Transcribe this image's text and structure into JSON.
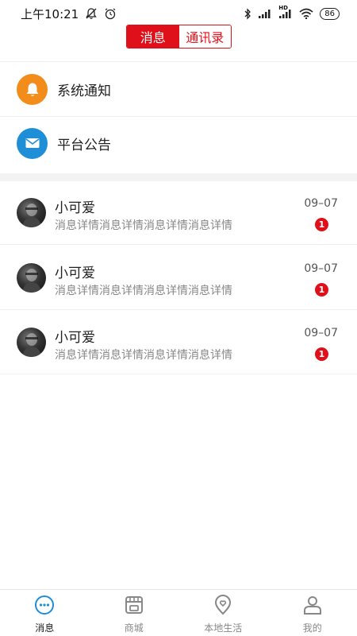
{
  "status_bar": {
    "time": "上午10:21",
    "battery": "86",
    "network_label": "HD"
  },
  "header": {
    "tabs": [
      {
        "label": "消息",
        "active": true
      },
      {
        "label": "通讯录",
        "active": false
      }
    ]
  },
  "quick_items": [
    {
      "label": "系统通知",
      "icon": "bell-icon",
      "color": "#f28c1a"
    },
    {
      "label": "平台公告",
      "icon": "mail-icon",
      "color": "#1e8fd6"
    }
  ],
  "messages": [
    {
      "name": "小可爱",
      "preview": "消息详情消息详情消息详情消息详情",
      "date": "09–07",
      "unread": "1"
    },
    {
      "name": "小可爱",
      "preview": "消息详情消息详情消息详情消息详情",
      "date": "09–07",
      "unread": "1"
    },
    {
      "name": "小可爱",
      "preview": "消息详情消息详情消息详情消息详情",
      "date": "09–07",
      "unread": "1"
    }
  ],
  "bottom_nav": [
    {
      "label": "消息",
      "icon": "chat-icon",
      "active": true
    },
    {
      "label": "商城",
      "icon": "shop-icon",
      "active": false
    },
    {
      "label": "本地生活",
      "icon": "location-heart-icon",
      "active": false
    },
    {
      "label": "我的",
      "icon": "user-icon",
      "active": false
    }
  ],
  "colors": {
    "accent": "#e0101a",
    "nav_active": "#1e8fd6",
    "muted": "#888888"
  }
}
